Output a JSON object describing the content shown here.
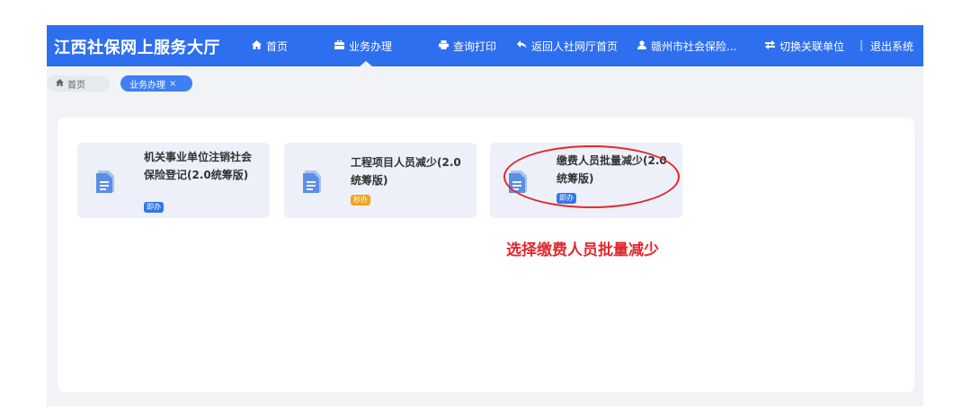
{
  "header": {
    "title": "江西社保网上服务大厅",
    "nav": [
      {
        "icon": "home-icon",
        "label": "首页"
      },
      {
        "icon": "briefcase-icon",
        "label": "业务办理"
      },
      {
        "icon": "print-icon",
        "label": "查询打印"
      },
      {
        "icon": "back-arrow-icon",
        "label": "返回人社网厅首页"
      },
      {
        "icon": "user-icon",
        "label": "赣州市社会保险..."
      },
      {
        "icon": "switch-icon",
        "label": "切换关联单位"
      },
      {
        "label": "退出系统"
      }
    ],
    "separator": "|"
  },
  "tabs": {
    "home_label": "首页",
    "active_label": "业务办理",
    "close_glyph": "×"
  },
  "cards": [
    {
      "title": "机关事业单位注销社会保险登记(2.0统筹版)",
      "badge": "即办",
      "badge_color": "#2f76ec"
    },
    {
      "title": "工程项目人员减少(2.0统筹版)",
      "badge": "秒办",
      "badge_color": "#f2a31b"
    },
    {
      "title": "缴费人员批量减少(2.0统筹版)",
      "badge": "即办",
      "badge_color": "#2f76ec"
    }
  ],
  "annotation": {
    "text": "选择缴费人员批量减少",
    "color": "#e5262b"
  },
  "colors": {
    "navbar": "#2e6ff0",
    "accent": "#3f7ef3"
  }
}
